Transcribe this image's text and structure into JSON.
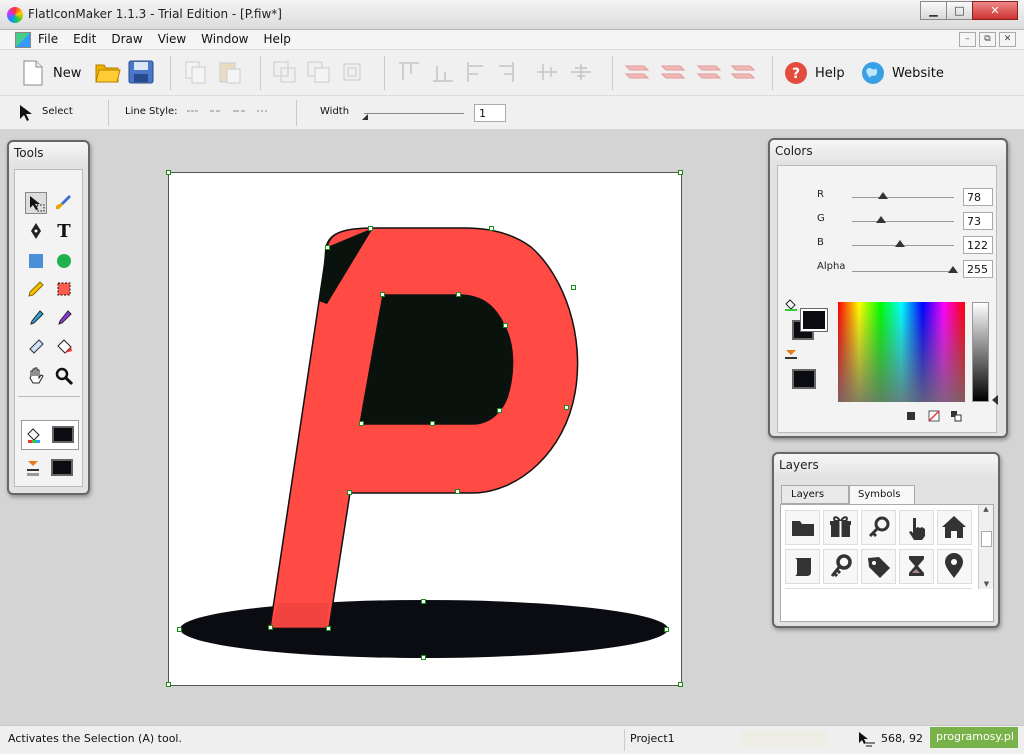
{
  "window": {
    "title": "FlatIconMaker 1.1.3 - Trial Edition - [P.fiw*]",
    "min": "▁",
    "max": "□",
    "close": "✕"
  },
  "menu": [
    "File",
    "Edit",
    "Draw",
    "View",
    "Window",
    "Help"
  ],
  "mdi_controls": [
    "–",
    "⧉",
    "✕"
  ],
  "toolbar": {
    "new_label": "New",
    "help_label": "Help",
    "website_label": "Website"
  },
  "toolbar2": {
    "select_label": "Select",
    "line_style_label": "Line Style:",
    "width_label": "Width",
    "width_value": "1"
  },
  "tools_panel": {
    "title": "Tools"
  },
  "colors_panel": {
    "title": "Colors",
    "r_label": "R",
    "r_value": "78",
    "g_label": "G",
    "g_value": "73",
    "b_label": "B",
    "b_value": "122",
    "alpha_label": "Alpha",
    "alpha_value": "255"
  },
  "layers_panel": {
    "title": "Layers",
    "tab_layers": "Layers",
    "tab_symbols": "Symbols"
  },
  "statusbar": {
    "hint": "Activates the Selection (A) tool.",
    "project": "Project1",
    "coords": "568, 92",
    "watermark": "programosy.pl"
  },
  "icon_names": [
    "new-icon",
    "open-folder-icon",
    "save-icon",
    "copy-icon",
    "paste-icon",
    "group-icon",
    "align-icon",
    "help-icon",
    "globe-icon",
    "pointer-icon",
    "folder-icon",
    "gift-icon",
    "key-icon",
    "hand-icon",
    "home-icon",
    "scroll-icon",
    "tag-icon",
    "hourglass-icon",
    "map-pin-icon"
  ],
  "colors": {
    "accent_red": "#ff4b44",
    "shadow": "#0b0b12",
    "current_color": "#4e497a"
  }
}
